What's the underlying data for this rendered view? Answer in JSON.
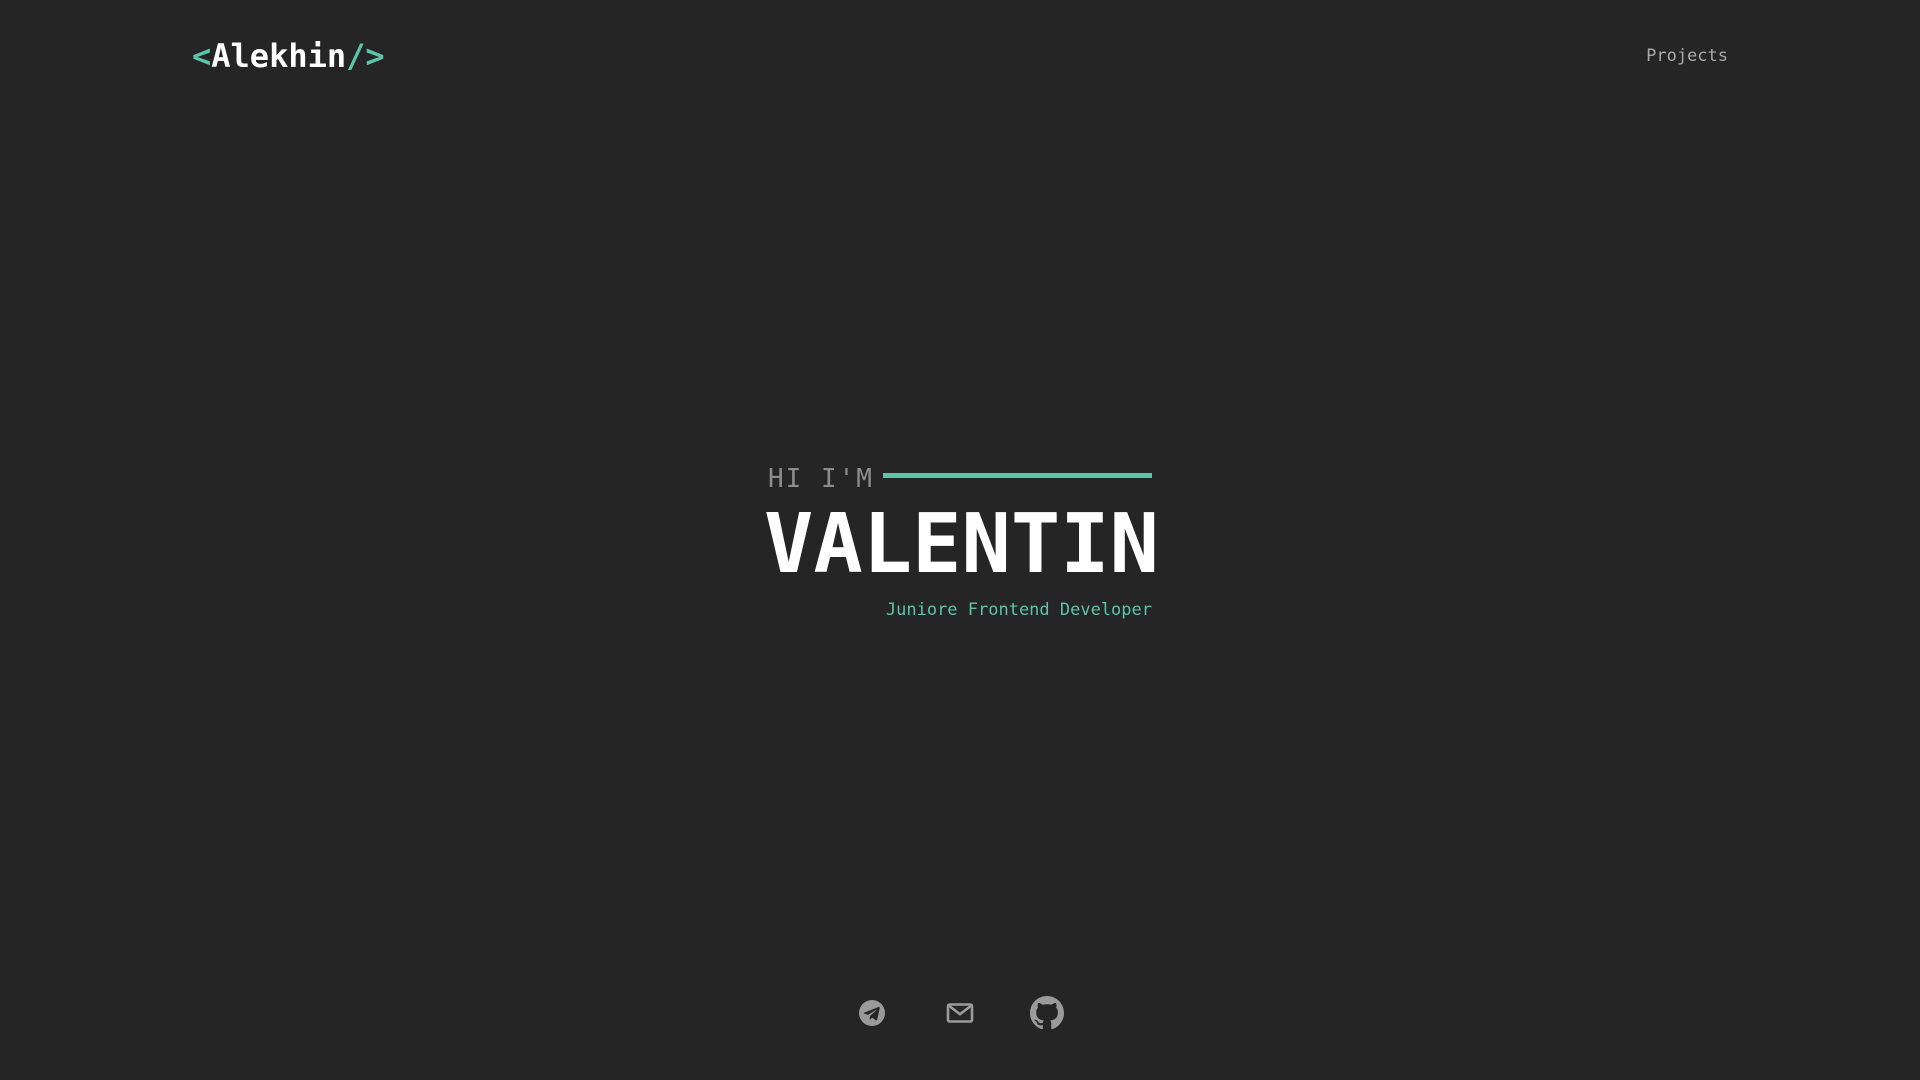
{
  "header": {
    "logo": {
      "open_bracket": "<",
      "name": "Alekhin",
      "close_bracket": "/>"
    },
    "nav": {
      "projects_label": "Projects"
    }
  },
  "hero": {
    "greeting": "HI I'M",
    "name": "VALENTIN",
    "role": "Juniore Frontend Developer"
  },
  "socials": [
    {
      "icon": "telegram-icon"
    },
    {
      "icon": "mail-icon"
    },
    {
      "icon": "github-icon"
    }
  ],
  "colors": {
    "background": "#252525",
    "accent": "#5cc4a8",
    "text": "#ffffff",
    "muted": "#8c8c8c",
    "icon": "#9a9a9a"
  }
}
